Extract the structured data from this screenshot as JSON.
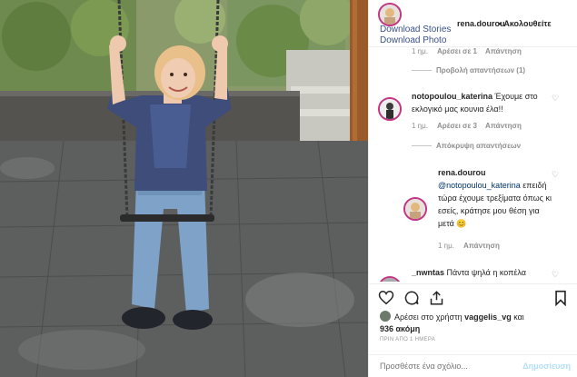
{
  "header": {
    "username": "rena.dourou",
    "separator": "•",
    "follow_label": "Ακολουθείτε",
    "download_stories": "Download Stories",
    "download_photo": "Download Photo"
  },
  "comments": {
    "top_reply_meta": {
      "time": "1 ημ.",
      "likes": "Αρέσει σε 1",
      "reply": "Απάντηση"
    },
    "view_replies": "Προβολή απαντήσεων (1)",
    "comment1": {
      "username": "notopoulou_katerina",
      "text": "Έχουμε στο εκλογικό μας κουνια έλα!!",
      "time": "1 ημ.",
      "likes": "Αρέσει σε 3",
      "reply": "Απάντηση"
    },
    "hide_replies": "Απόκρυψη απαντήσεων",
    "reply1": {
      "username": "rena.dourou",
      "mention": "@notopoulou_katerina",
      "text": "επειδή τώρα έχουμε τρεξίματα όπως κι εσείς, κράτησε μου θέση για μετά",
      "emoji": "😊",
      "time": "1 ημ.",
      "reply": "Απάντηση"
    },
    "comment2": {
      "username": "_nwntas",
      "text": "Πάντα ψηλά η κοπέλα"
    }
  },
  "likes": {
    "prefix": "Αρέσει στο χρήστη",
    "user": "vaggelis_vg",
    "and": "και",
    "count": "936 ακόμη"
  },
  "date_label": "ΠΡΙΝ ΑΠΟ 1 ΗΜΕΡΑ",
  "add_comment": {
    "placeholder": "Προσθέστε ένα σχόλιο...",
    "post_label": "Δημοσίευση"
  },
  "colors": {
    "link": "#385185",
    "mention": "#003569",
    "meta": "#8e8e8e",
    "post_disabled": "#b2dffc",
    "story_ring": "#c13584"
  },
  "icons": [
    "heart-icon",
    "comment-icon",
    "share-icon",
    "bookmark-icon"
  ]
}
